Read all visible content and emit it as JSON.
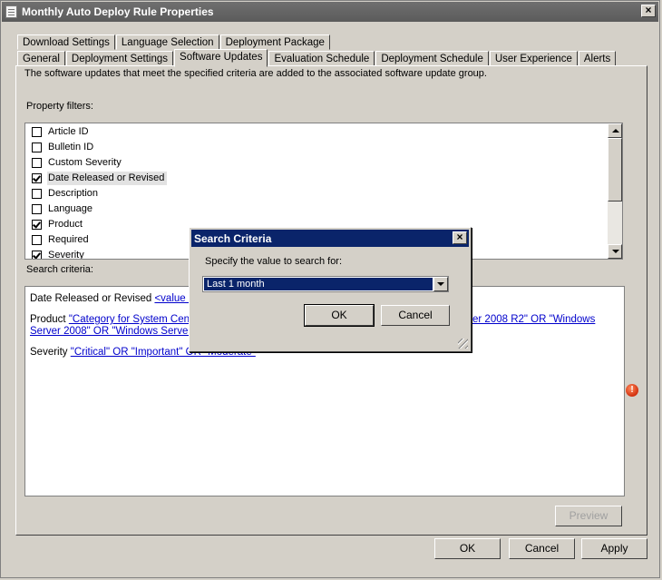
{
  "window": {
    "title": "Monthly Auto Deploy Rule Properties",
    "close_label": "×"
  },
  "tabs_row1": [
    {
      "label": "Download Settings"
    },
    {
      "label": "Language Selection"
    },
    {
      "label": "Deployment Package"
    }
  ],
  "tabs_row2": [
    {
      "label": "General"
    },
    {
      "label": "Deployment Settings"
    },
    {
      "label": "Software Updates",
      "active": true
    },
    {
      "label": "Evaluation Schedule"
    },
    {
      "label": "Deployment Schedule"
    },
    {
      "label": "User Experience"
    },
    {
      "label": "Alerts"
    }
  ],
  "panel": {
    "description": "The software updates that meet the specified criteria are added to the associated software update group.",
    "property_filters_label": "Property filters:",
    "search_criteria_label": "Search criteria:"
  },
  "filters": [
    {
      "label": "Article ID",
      "checked": false
    },
    {
      "label": "Bulletin ID",
      "checked": false
    },
    {
      "label": "Custom Severity",
      "checked": false
    },
    {
      "label": "Date Released or Revised",
      "checked": true,
      "selected": true
    },
    {
      "label": "Description",
      "checked": false
    },
    {
      "label": "Language",
      "checked": false
    },
    {
      "label": "Product",
      "checked": true
    },
    {
      "label": "Required",
      "checked": false
    },
    {
      "label": "Severity",
      "checked": true
    }
  ],
  "criteria": {
    "date_label": "Date Released or Revised",
    "date_link": "<value to",
    "product_label": "Product",
    "product_link_1": "\"Category for System Center",
    "product_link_2": "er 2008 R2\" OR \"Windows",
    "product_link_3": "Server 2008\" OR \"Windows Server 2",
    "severity_label": "Severity",
    "severity_link": "\"Critical\" OR \"Important\" OR \"Moderate\""
  },
  "preview_label": "Preview",
  "footer": {
    "ok": "OK",
    "cancel": "Cancel",
    "apply": "Apply"
  },
  "error_icon_glyph": "!",
  "dialog": {
    "title": "Search Criteria",
    "close_label": "×",
    "prompt": "Specify the value to search for:",
    "selected_value": "Last 1 month",
    "ok": "OK",
    "cancel": "Cancel"
  }
}
